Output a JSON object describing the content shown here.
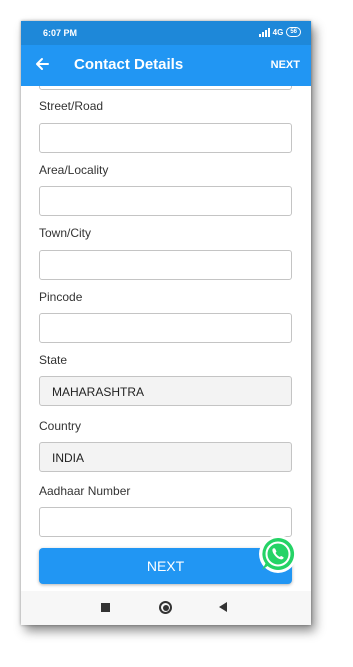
{
  "status_bar": {
    "time": "6:07 PM",
    "network": "4G",
    "battery": "56"
  },
  "app_bar": {
    "title": "Contact Details",
    "next_label": "NEXT"
  },
  "form": {
    "street": {
      "label": "Street/Road",
      "value": ""
    },
    "area": {
      "label": "Area/Locality",
      "value": ""
    },
    "town": {
      "label": "Town/City",
      "value": ""
    },
    "pincode": {
      "label": "Pincode",
      "value": ""
    },
    "state": {
      "label": "State",
      "value": "MAHARASHTRA"
    },
    "country": {
      "label": "Country",
      "value": "INDIA"
    },
    "aadhaar": {
      "label": "Aadhaar Number",
      "value": ""
    }
  },
  "next_button_label": "NEXT",
  "icons": {
    "back": "arrow-left-icon",
    "whatsapp": "whatsapp-icon",
    "nav_recents": "square-icon",
    "nav_home": "circle-icon",
    "nav_back": "triangle-back-icon"
  },
  "colors": {
    "primary": "#2196f3",
    "status_bar": "#1e88d9",
    "whatsapp": "#25d366"
  }
}
